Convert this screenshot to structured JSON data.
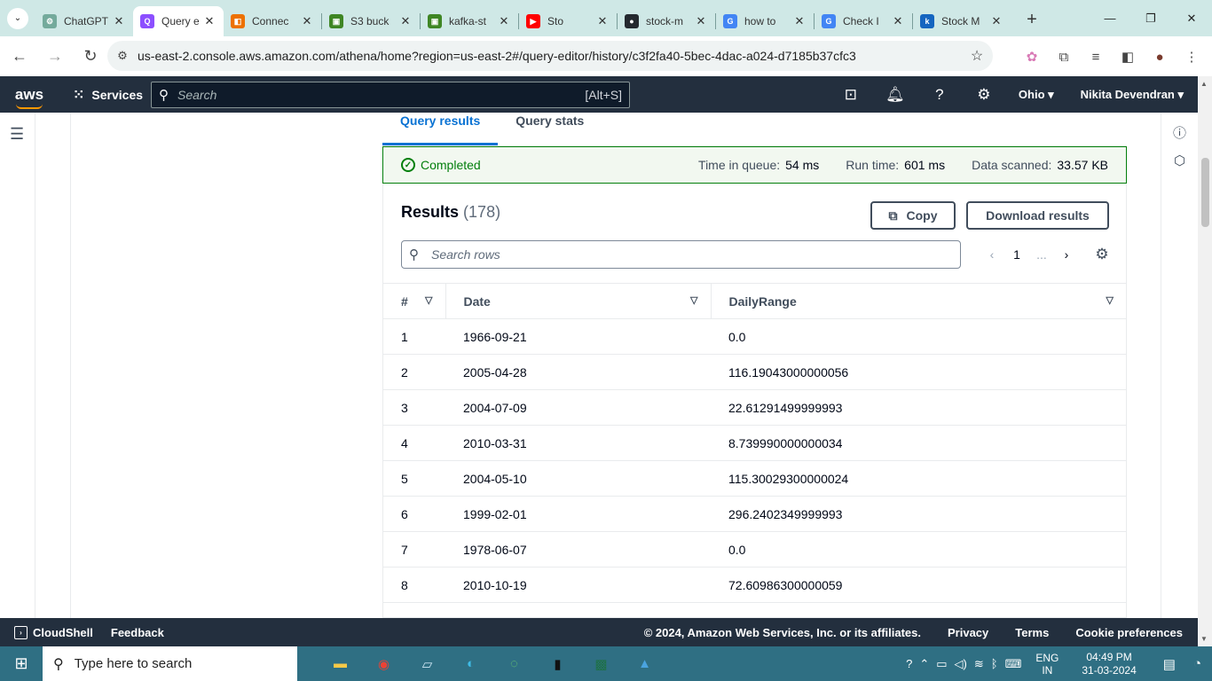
{
  "browser": {
    "tabs": [
      {
        "title": "ChatGPT",
        "fav_color": "#74aa9c",
        "fav": "⚙"
      },
      {
        "title": "Query e",
        "fav_color": "#8c4fff",
        "fav": "Q",
        "active": true
      },
      {
        "title": "Connec",
        "fav_color": "#ed7100",
        "fav": "◧"
      },
      {
        "title": "S3 buck",
        "fav_color": "#3f8624",
        "fav": "▣"
      },
      {
        "title": "kafka-st",
        "fav_color": "#3f8624",
        "fav": "▣"
      },
      {
        "title": "Sto",
        "fav_color": "#ff0000",
        "fav": "▶"
      },
      {
        "title": "stock-m",
        "fav_color": "#24292f",
        "fav": "●"
      },
      {
        "title": "how to",
        "fav_color": "#4285f4",
        "fav": "G"
      },
      {
        "title": "Check I",
        "fav_color": "#4285f4",
        "fav": "G"
      },
      {
        "title": "Stock M",
        "fav_color": "#1565c0",
        "fav": "k"
      }
    ],
    "url": "us-east-2.console.aws.amazon.com/athena/home?region=us-east-2#/query-editor/history/c3f2fa40-5bec-4dac-a024-d7185b37cfc3"
  },
  "aws": {
    "logo": "aws",
    "services_label": "Services",
    "search_placeholder": "Search",
    "search_hint": "[Alt+S]",
    "region": "Ohio",
    "user": "Nikita Devendran"
  },
  "results": {
    "tabs": [
      "Query results",
      "Query stats"
    ],
    "status": "Completed",
    "queue_label": "Time in queue:",
    "queue_value": "54 ms",
    "run_label": "Run time:",
    "run_value": "601 ms",
    "scanned_label": "Data scanned:",
    "scanned_value": "33.57 KB",
    "heading": "Results",
    "count": "(178)",
    "copy_label": "Copy",
    "download_label": "Download results",
    "search_placeholder": "Search rows",
    "page": "1",
    "ellipsis": "...",
    "columns": [
      "#",
      "Date",
      "DailyRange"
    ],
    "rows": [
      [
        "1",
        "1966-09-21",
        "0.0"
      ],
      [
        "2",
        "2005-04-28",
        "116.19043000000056"
      ],
      [
        "3",
        "2004-07-09",
        "22.61291499999993"
      ],
      [
        "4",
        "2010-03-31",
        "8.739990000000034"
      ],
      [
        "5",
        "2004-05-10",
        "115.30029300000024"
      ],
      [
        "6",
        "1999-02-01",
        "296.2402349999993"
      ],
      [
        "7",
        "1978-06-07",
        "0.0"
      ],
      [
        "8",
        "2010-10-19",
        "72.60986300000059"
      ]
    ]
  },
  "footer": {
    "cloudshell": "CloudShell",
    "feedback": "Feedback",
    "copyright": "© 2024, Amazon Web Services, Inc. or its affiliates.",
    "privacy": "Privacy",
    "terms": "Terms",
    "cookies": "Cookie preferences"
  },
  "taskbar": {
    "search_text": "Type here to search",
    "lang1": "ENG",
    "lang2": "IN",
    "time": "04:49 PM",
    "date": "31-03-2024"
  }
}
